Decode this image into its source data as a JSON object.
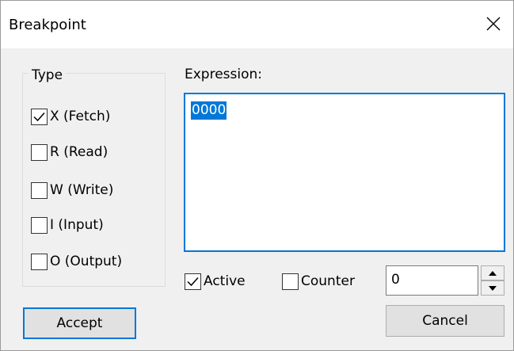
{
  "dialog": {
    "title": "Breakpoint"
  },
  "type_group": {
    "legend": "Type",
    "options": [
      {
        "label": "X (Fetch)",
        "checked": true
      },
      {
        "label": "R (Read)",
        "checked": false
      },
      {
        "label": "W (Write)",
        "checked": false
      },
      {
        "label": "I (Input)",
        "checked": false
      },
      {
        "label": "O (Output)",
        "checked": false
      }
    ]
  },
  "expression": {
    "label": "Expression:",
    "value": "0000"
  },
  "active": {
    "label": "Active",
    "checked": true
  },
  "counter": {
    "label": "Counter",
    "checked": false,
    "value": "0"
  },
  "buttons": {
    "accept": "Accept",
    "cancel": "Cancel"
  },
  "icons": {
    "close": "close-icon",
    "check": "checkmark-icon",
    "spin_up": "triangle-up-icon",
    "spin_down": "triangle-down-icon"
  }
}
